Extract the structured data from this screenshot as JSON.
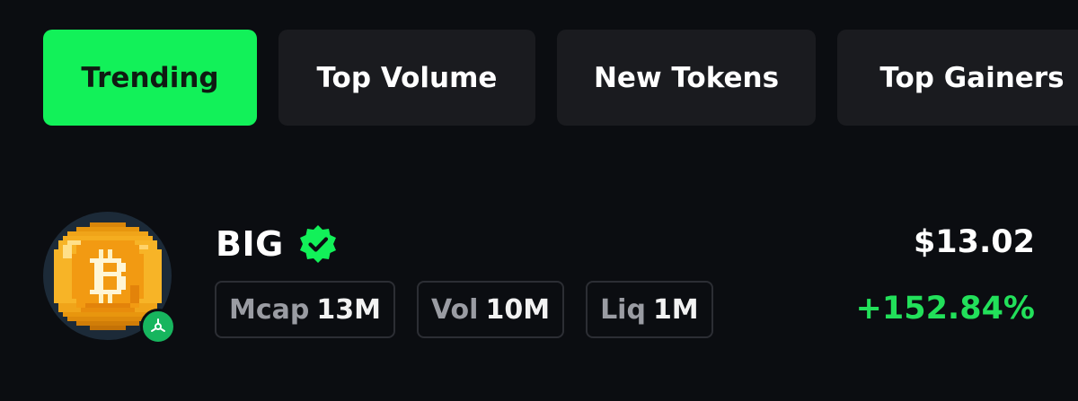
{
  "tabs": [
    {
      "label": "Trending",
      "active": true
    },
    {
      "label": "Top Volume",
      "active": false
    },
    {
      "label": "New Tokens",
      "active": false
    },
    {
      "label": "Top Gainers",
      "active": false
    }
  ],
  "token": {
    "symbol": "BIG",
    "verified": true,
    "logo_icon": "pixel-bitcoin-coin-icon",
    "chain_icon": "solana-like-chain-badge-icon",
    "stats": [
      {
        "label": "Mcap",
        "value": "13M"
      },
      {
        "label": "Vol",
        "value": "10M"
      },
      {
        "label": "Liq",
        "value": "1M"
      }
    ],
    "price": "$13.02",
    "change": "+152.84%"
  },
  "colors": {
    "background": "#0b0d11",
    "accent_green": "#12f159",
    "positive": "#22e05a",
    "tab_bg": "#1a1b1f",
    "verified_green": "#12f159"
  }
}
